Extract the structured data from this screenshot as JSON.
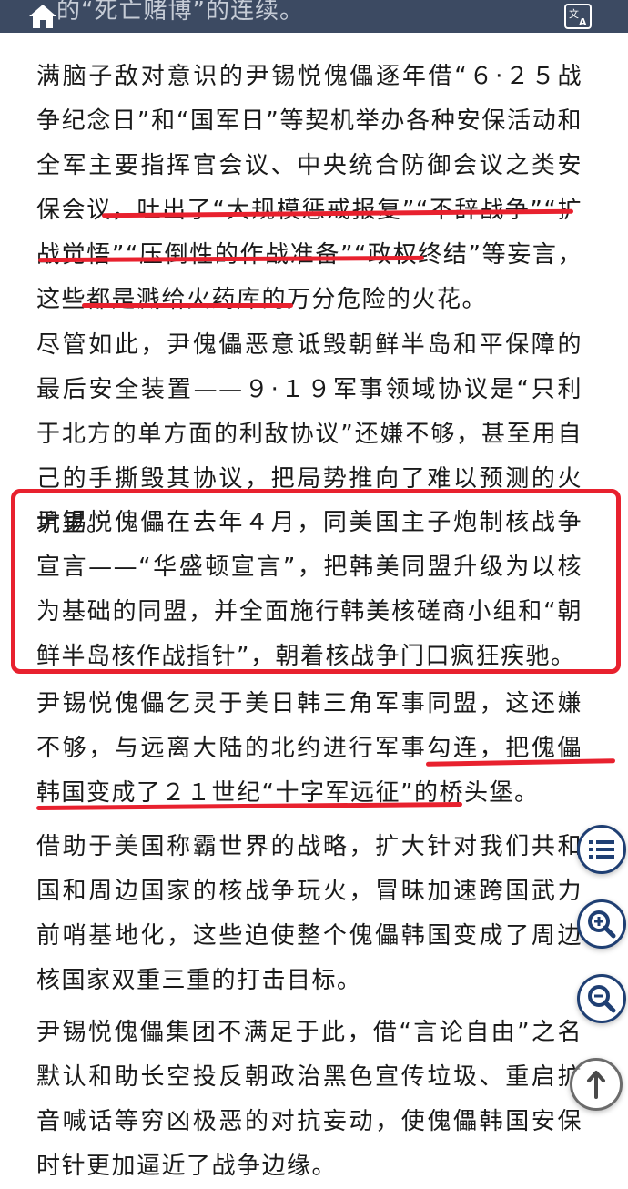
{
  "header": {
    "title": "的“死亡赌博”的连续。",
    "home_icon": "home-icon",
    "translate_icon": "translate-icon"
  },
  "article": {
    "paragraphs": [
      "满脑子敌对意识的尹锡悦傀儡逐年借“６·２５战争纪念日”和“国军日”等契机举办各种安保活动和全军主要指挥官会议、中央统合防御会议之类安保会议，吐出了“大规模惩戒报复”“不辞战争”“扩战觉悟”“压倒性的作战准备”“政权终结”等妄言，这些都是溅给火药库的万分危险的火花。",
      "尽管如此，尹傀儡恶意诋毁朝鲜半岛和平保障的最后安全装置——９·１９军事领域协议是“只利于北方的单方面的利敌协议”还嫌不够，甚至用自己的手撕毁其协议，把局势推向了难以预测的火坑里。",
      "尹锡悦傀儡在去年４月，同美国主子炮制核战争宣言——“华盛顿宣言”，把韩美同盟升级为以核为基础的同盟，并全面施行韩美核磋商小组和“朝鲜半岛核作战指针”，朝着核战争门口疯狂疾驰。",
      "尹锡悦傀儡乞灵于美日韩三角军事同盟，这还嫌不够，与远离大陆的北约进行军事勾连，把傀儡韩国变成了２１世纪“十字军远征”的桥头堡。",
      "借助于美国称霸世界的战略，扩大针对我们共和国和周边国家的核战争玩火，冒昧加速跨国武力前哨基地化，这些迫使整个傀儡韩国变成了周边核国家双重三重的打击目标。",
      "尹锡悦傀儡集团不满足于此，借“言论自由”之名默认和助长空投反朝政治黑色宣传垃圾、重启扩音喊话等穷凶极恶的对抗妄动，使傀儡韩国安保时针更加逼近了战争边缘。"
    ]
  },
  "floating_buttons": {
    "menu": "list-icon",
    "zoom_in": "zoom-in-icon",
    "zoom_out": "zoom-out-icon",
    "scroll_top": "arrow-up-icon"
  },
  "colors": {
    "header_bg": "#3c4a62",
    "annotation_red": "#e8212e",
    "fab_border": "#1f3f73"
  }
}
